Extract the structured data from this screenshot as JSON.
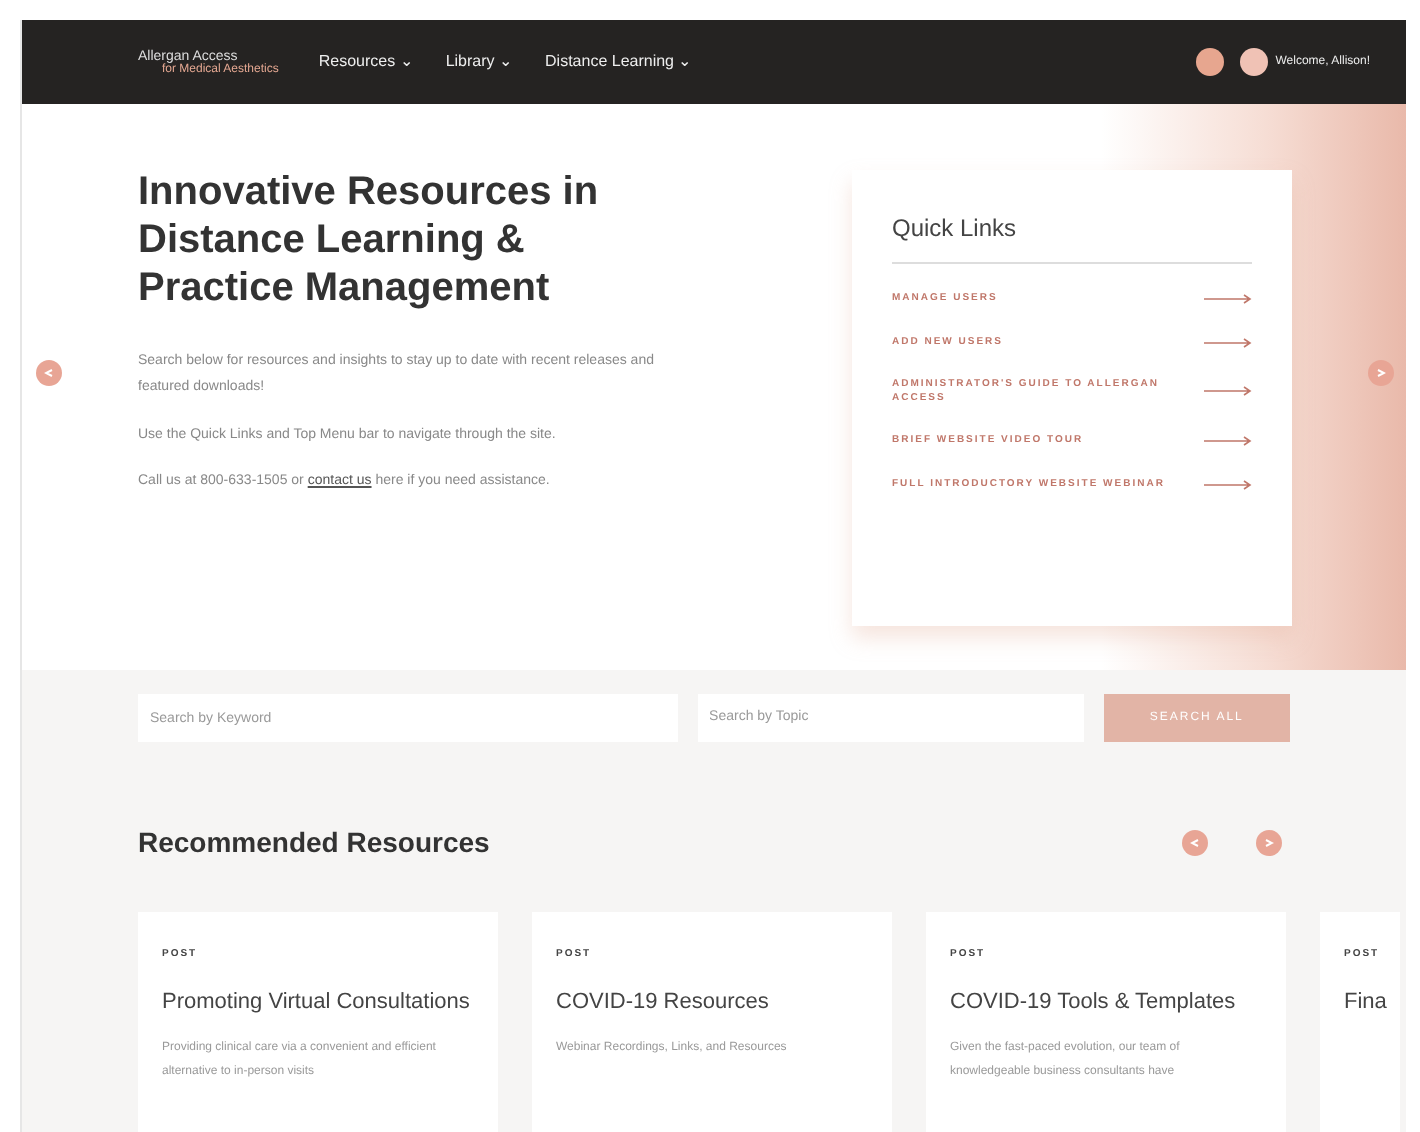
{
  "navbar": {
    "logo_line_1": "Allergan Access",
    "logo_line_2": "for Medical Aesthetics",
    "menu": [
      {
        "label": "Resources",
        "caret": "⌄"
      },
      {
        "label": "Library",
        "caret": "⌄"
      },
      {
        "label": "Distance Learning",
        "caret": "⌄"
      }
    ],
    "welcome": "Welcome, Allison!"
  },
  "hero": {
    "title": "Innovative Resources in Distance Learning & Practice Management",
    "paragraphs": [
      "Search below for resources and insights to stay up to date with recent releases and featured downloads!",
      "Use the Quick Links and Top Menu bar to navigate through the site."
    ],
    "contact": {
      "before": "Call us at 800-633-1505 or ",
      "link": "contact us",
      "after": " here if you need assistance."
    }
  },
  "quick_links": {
    "title": "Quick Links",
    "items": [
      "MANAGE USERS",
      "ADD NEW USERS",
      "ADMINISTRATOR'S GUIDE TO ALLERGAN ACCESS",
      "BRIEF WEBSITE VIDEO TOUR",
      "FULL INTRODUCTORY WEBSITE WEBINAR"
    ]
  },
  "search": {
    "keyword_placeholder": "Search by Keyword",
    "topic_placeholder": "Search by Topic",
    "button": "SEARCH ALL"
  },
  "recommended": {
    "title": "Recommended Resources",
    "cards": [
      {
        "tag": "POST",
        "title": "Promoting Virtual Consultations",
        "description": "Providing clinical care via a convenient and efficient alternative to in-person visits"
      },
      {
        "tag": "POST",
        "title": "COVID-19 Resources",
        "description": "Webinar Recordings, Links, and Resources"
      },
      {
        "tag": "POST",
        "title": "COVID-19 Tools & Templates",
        "description": "Given the fast-paced evolution, our team of knowledgeable business consultants have"
      },
      {
        "tag": "POST",
        "title": "Fina"
      }
    ]
  }
}
